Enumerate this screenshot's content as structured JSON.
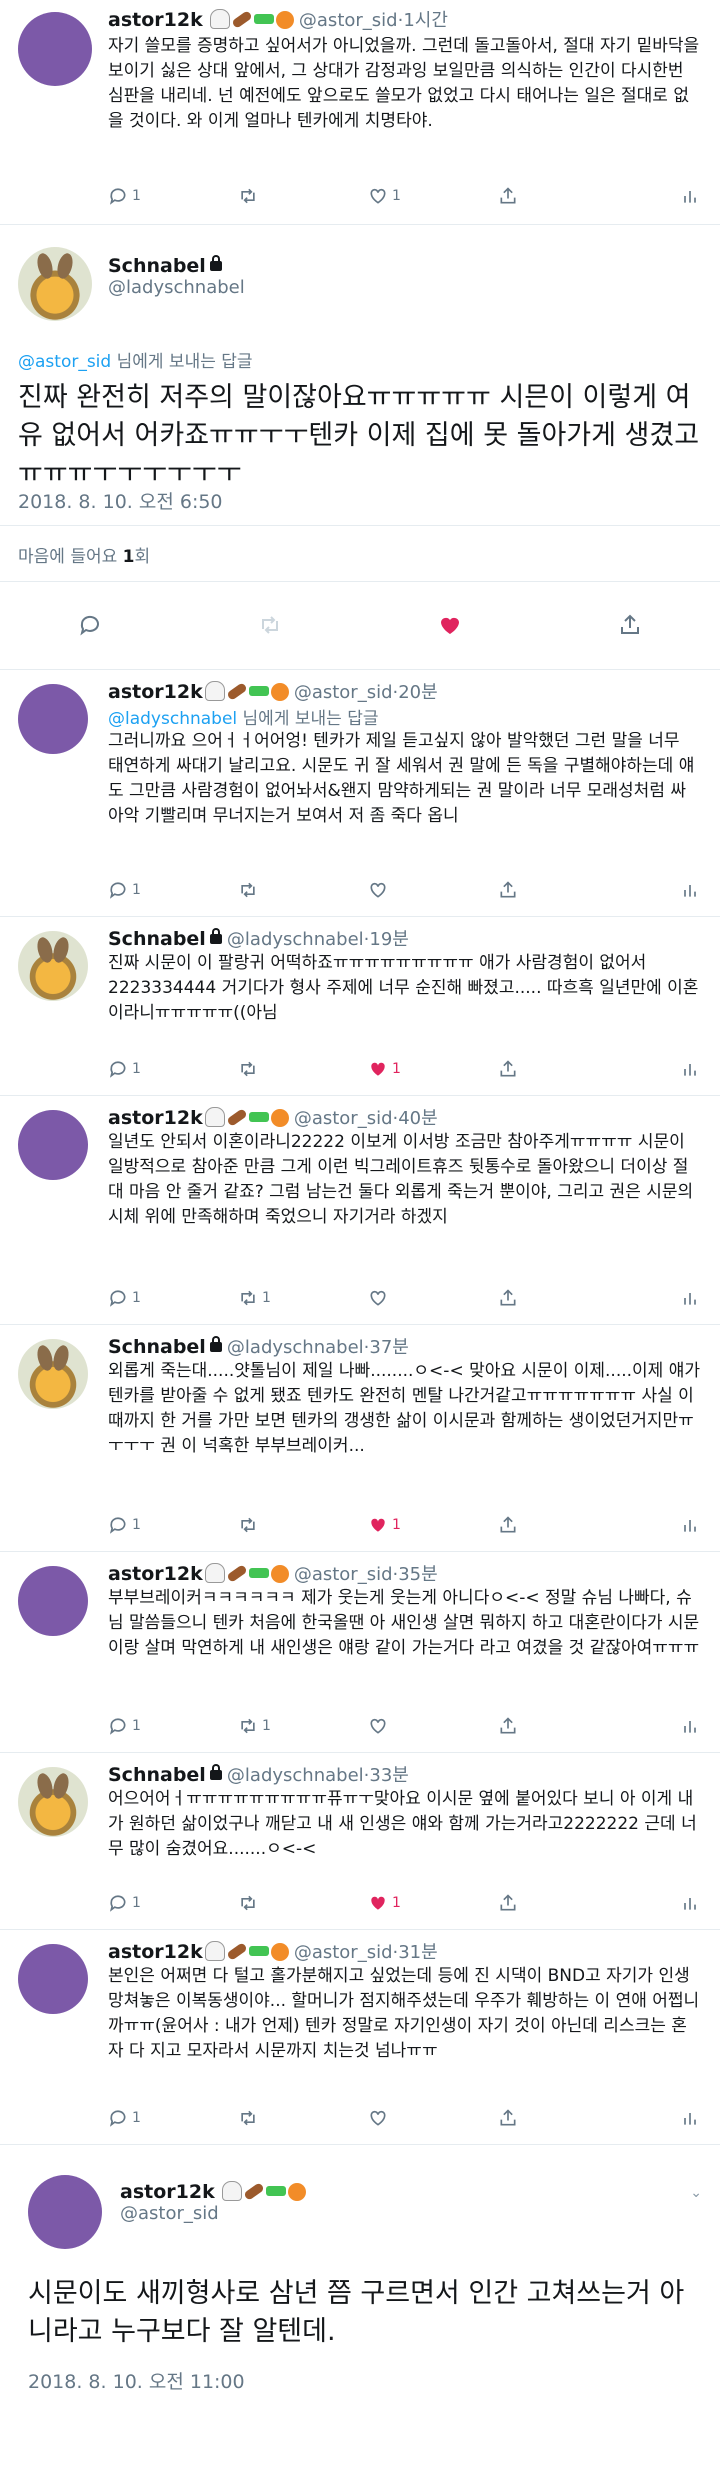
{
  "colors": {
    "accent": "#1da1f2",
    "like": "#e0245e",
    "muted": "#657786",
    "avatar_purple": "#7c59a8"
  },
  "tweets_top": [
    {
      "name": "astor12k",
      "handle": "@astor_sid",
      "time": "1시간",
      "text": "자기 쓸모를 증명하고 싶어서가 아니었을까. 그런데 돌고돌아서, 절대 자기 밑바닥을 보이기 싫은 상대 앞에서, 그 상대가 감정과잉 보일만큼 의식하는 인간이 다시한번 심판을 내리네. 넌 예전에도 앞으로도 쓸모가 없었고 다시 태어나는 일은 절대로 없을 것이다. 와 이게 얼마나 텐카에게 치명타야.",
      "replies": "1",
      "retweets": "",
      "likes": "1"
    }
  ],
  "main_tweet": {
    "name": "Schnabel",
    "handle": "@ladyschnabel",
    "reply_prefix": "@astor_sid",
    "reply_suffix": " 님에게 보내는 답글",
    "text": "진짜 완전히 저주의 말이잖아요ㅠㅠㅠㅠㅠ 시믄이 이렇게 여유 없어서 어카죠ㅠㅠㅜㅜ텐카 이제 집에 못 돌아가게 생겼고ㅠㅠㅠㅜㅜㅜㅜㅜㅜ",
    "timestamp": "2018. 8. 10. 오전 6:50",
    "stats_label": "마음에 들어요 ",
    "stats_count": "1",
    "stats_unit": "회"
  },
  "replies": [
    {
      "name": "astor12k",
      "handle": "@astor_sid",
      "time": "20분",
      "reply_prefix": "@ladyschnabel",
      "reply_suffix": " 님에게 보내는 답글",
      "text": "그러니까요 으어ㅓㅓ어어엉! 텐카가 제일 듣고싶지 않아 발악했던 그런 말을 너무 태연하게 싸대기 날리고요. 시문도 귀 잘 세워서 권 말에 든 독을 구별해야하는데 얘도 그만큼 사람경험이 없어놔서&왠지 맘약하게되는 권 말이라 너무 모래성처럼 싸아악 기빨리며 무너지는거 보여서 저 좀 죽다 옵니",
      "replies": "1",
      "retweets": "",
      "likes": ""
    },
    {
      "name": "Schnabel",
      "handle": "@ladyschnabel",
      "time": "19분",
      "text": "진짜 시문이 이 팔랑귀 어떡하죠ㅠㅠㅠㅠㅠㅠㅠㅠㅠ 애가 사람경험이 없어서2223334444 거기다가 형사 주제에 너무 순진해 빠졌고..... 따흐흑 일년만에 이혼이라니ㅠㅠㅠㅠㅠ((아님",
      "replies": "1",
      "retweets": "",
      "likes": "1"
    },
    {
      "name": "astor12k",
      "handle": "@astor_sid",
      "time": "40분",
      "text": "일년도 안되서 이혼이라니22222 이보게 이서방 조금만 참아주게ㅠㅠㅠㅠ 시문이 일방적으로 참아준 만큼 그게 이런 빅그레이트휴즈 뒷통수로 돌아왔으니 더이상 절대 마음 안 줄거 같죠? 그럼 남는건 둘다 외롭게 죽는거 뿐이야, 그리고 권은 시문의 시체 위에 만족해하며 죽었으니 자기거라 하겠지",
      "replies": "1",
      "retweets": "1",
      "likes": ""
    },
    {
      "name": "Schnabel",
      "handle": "@ladyschnabel",
      "time": "37분",
      "text": "외롭게 죽는대.....얏톨님이 제일 나빠........ㅇ<-< 맞아요 시문이 이제.....이제 얘가 텐카를 받아줄 수 없게 됐죠 텐카도 완전히 멘탈 나간거같고ㅠㅠㅠㅠㅠㅠㅠ 사실 이때까지 한 거를 가만 보면 텐카의 갱생한 삶이 이시문과 함께하는 생이었던거지만ㅠㅜㅜㅜ 권 이 넉혹한 부부브레이커...",
      "replies": "1",
      "retweets": "",
      "likes": "1"
    },
    {
      "name": "astor12k",
      "handle": "@astor_sid",
      "time": "35분",
      "text": "부부브레이커ㅋㅋㅋㅋㅋㅋ 제가 웃는게 웃는게 아니다ㅇ<-< 정말 슈님 나빠다, 슈님 말씀들으니 텐카 처음에 한국올땐 아 새인생 살면 뭐하지 하고 대혼란이다가 시문이랑 살며 막연하게 내 새인생은 얘랑 같이 가는거다 라고 여겼을 것 같잖아여ㅠㅠㅠ",
      "replies": "1",
      "retweets": "1",
      "likes": ""
    },
    {
      "name": "Schnabel",
      "handle": "@ladyschnabel",
      "time": "33분",
      "text": "어으어어ㅓㅠㅠㅠㅠㅠㅠㅠㅠㅠ퓨ㅠㅜ맞아요 이시문 옆에 붙어있다 보니 아 이게 내가 원하던 삶이었구나 깨닫고 내 새 인생은 얘와 함께 가는거라고2222222 근데 너무 많이 숨겼어요.......ㅇ<-<",
      "replies": "1",
      "retweets": "",
      "likes": "1"
    },
    {
      "name": "astor12k",
      "handle": "@astor_sid",
      "time": "31분",
      "text": "본인은 어쩌면 다 털고 홀가분해지고 싶었는데 등에 진 시댁이 BND고 자기가 인생 망쳐놓은 이복동생이야... 할머니가 점지해주셨는데 우주가 훼방하는 이 연애 어쩝니까ㅠㅠ(윤어사 : 내가 언제) 텐카 정말로 자기인생이 자기 것이 아닌데 리스크는 혼자 다 지고 모자라서 시문까지 치는것 넘나ㅠㅠ",
      "replies": "1",
      "retweets": "",
      "likes": ""
    }
  ],
  "final_tweet": {
    "name": "astor12k",
    "handle": "@astor_sid",
    "text": "시문이도 새끼형사로 삼년 쯤 구르면서 인간 고쳐쓰는거 아니라고 누구보다 잘 알텐데.",
    "timestamp": "2018. 8. 10. 오전 11:00"
  }
}
